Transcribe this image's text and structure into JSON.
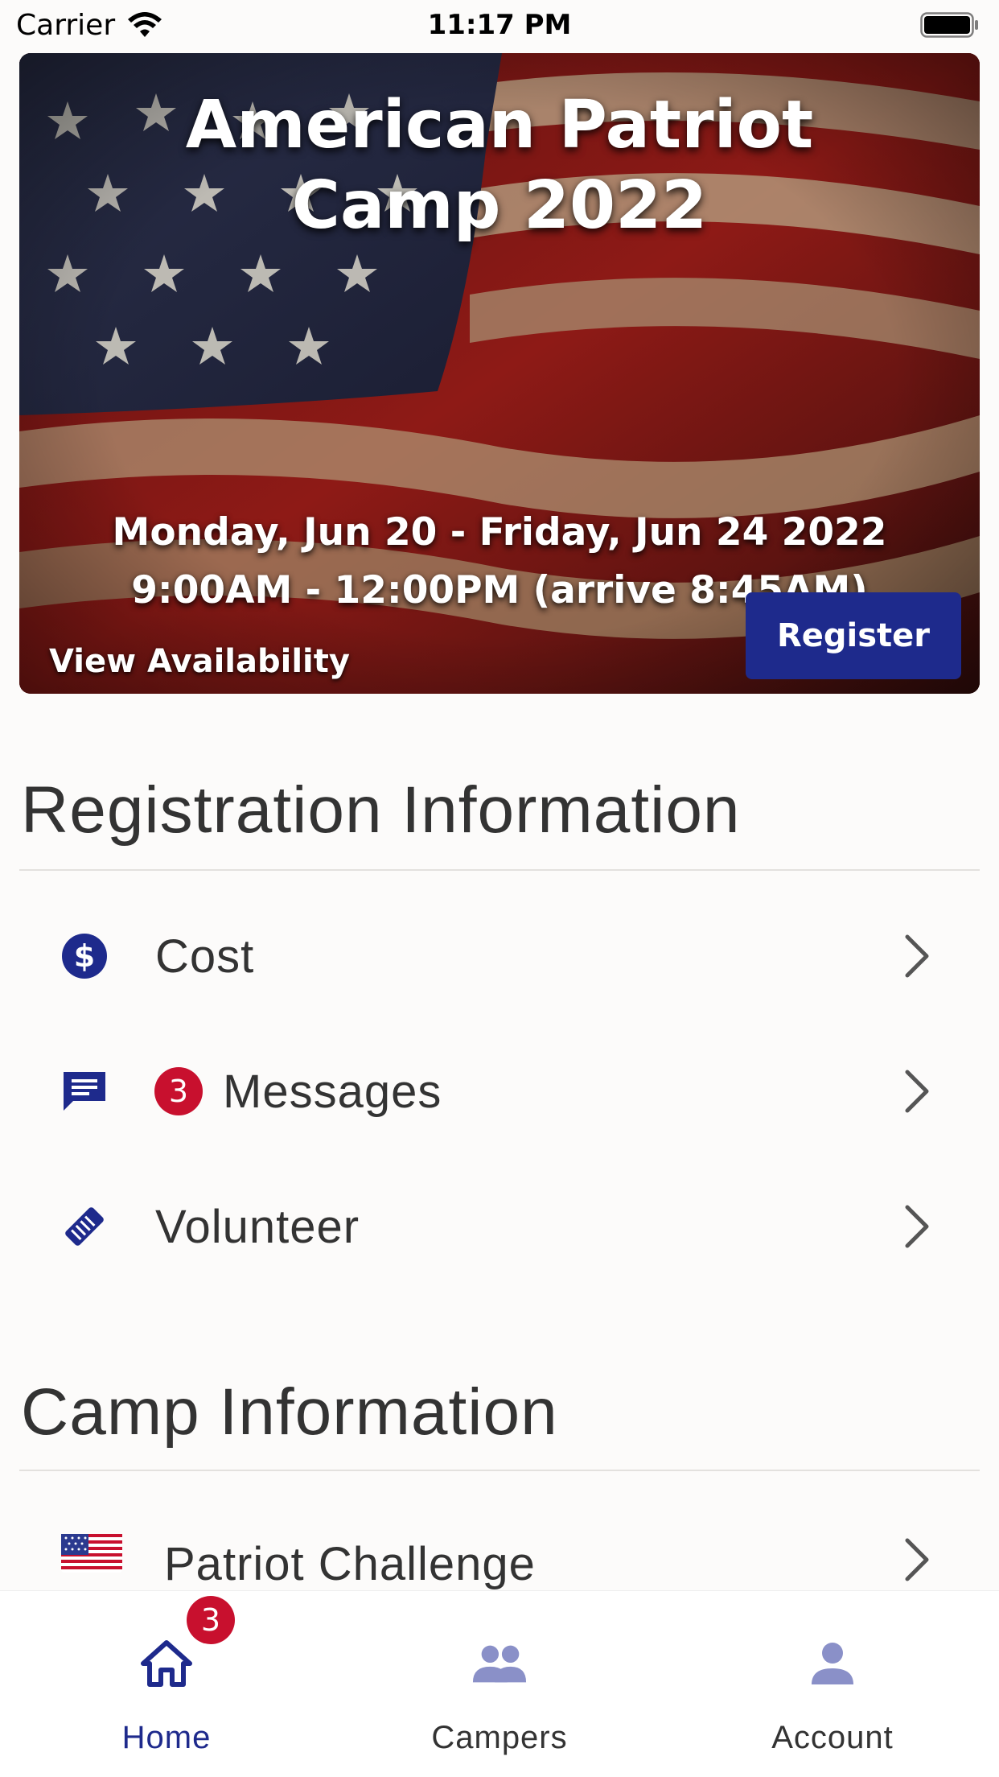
{
  "status_bar": {
    "carrier": "Carrier",
    "time": "11:17 PM"
  },
  "hero": {
    "title": "American Patriot Camp 2022",
    "dates": "Monday, Jun 20 - Friday, Jun 24 2022",
    "times": "9:00AM - 12:00PM (arrive 8:45AM)",
    "view_availability": "View Availability",
    "register": "Register"
  },
  "registration_section": {
    "title": "Registration Information",
    "items": [
      {
        "label": "Cost",
        "icon": "dollar-icon"
      },
      {
        "label": "Messages",
        "icon": "message-icon",
        "badge": "3"
      },
      {
        "label": "Volunteer",
        "icon": "handshake-icon"
      }
    ]
  },
  "camp_section": {
    "title": "Camp Information",
    "items": [
      {
        "label": "Patriot Challenge",
        "icon": "us-flag-icon"
      }
    ]
  },
  "tab_bar": {
    "tabs": [
      {
        "label": "Home",
        "icon": "home-icon",
        "badge": "3",
        "active": true
      },
      {
        "label": "Campers",
        "icon": "people-icon",
        "active": false
      },
      {
        "label": "Account",
        "icon": "person-icon",
        "active": false
      }
    ]
  },
  "colors": {
    "accent": "#1e2a8c",
    "badge": "#c8102e",
    "inactive_icon": "#8a90c8"
  }
}
